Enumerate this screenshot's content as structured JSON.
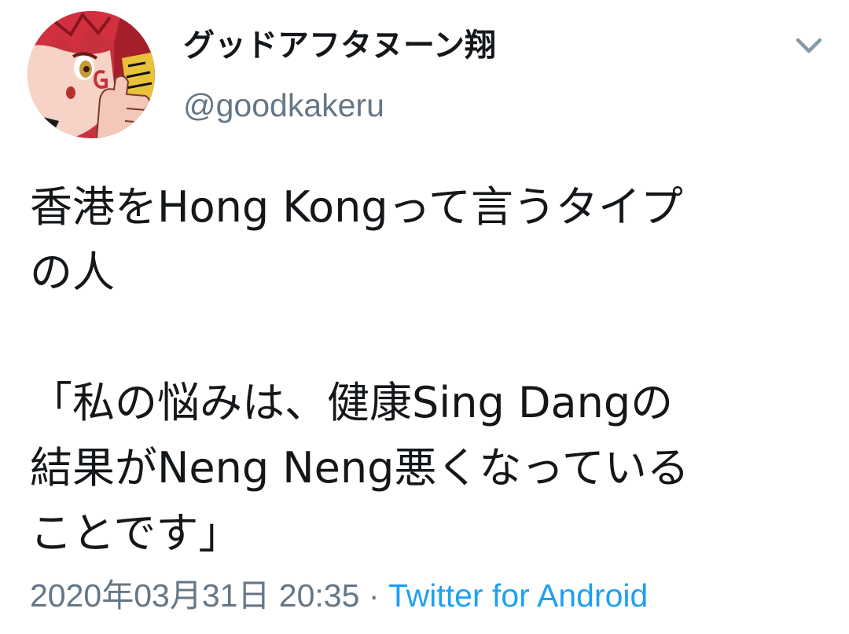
{
  "author": {
    "display_name": "グッドアフタヌーン翔",
    "handle": "@goodkakeru"
  },
  "tweet": {
    "lines": [
      "香港をHong Kongって言うタイプ",
      "の人",
      "",
      "「私の悩みは、健康Sing Dangの",
      "結果がNeng Neng悪くなっている",
      "ことです」"
    ]
  },
  "meta": {
    "timestamp": "2020年03月31日 20:35",
    "separator": " · ",
    "source": "Twitter for Android"
  },
  "icons": {
    "menu": "chevron-down-icon",
    "avatar": "user-avatar"
  },
  "colors": {
    "text": "#14171a",
    "secondary": "#657786",
    "link": "#1da1f2"
  }
}
